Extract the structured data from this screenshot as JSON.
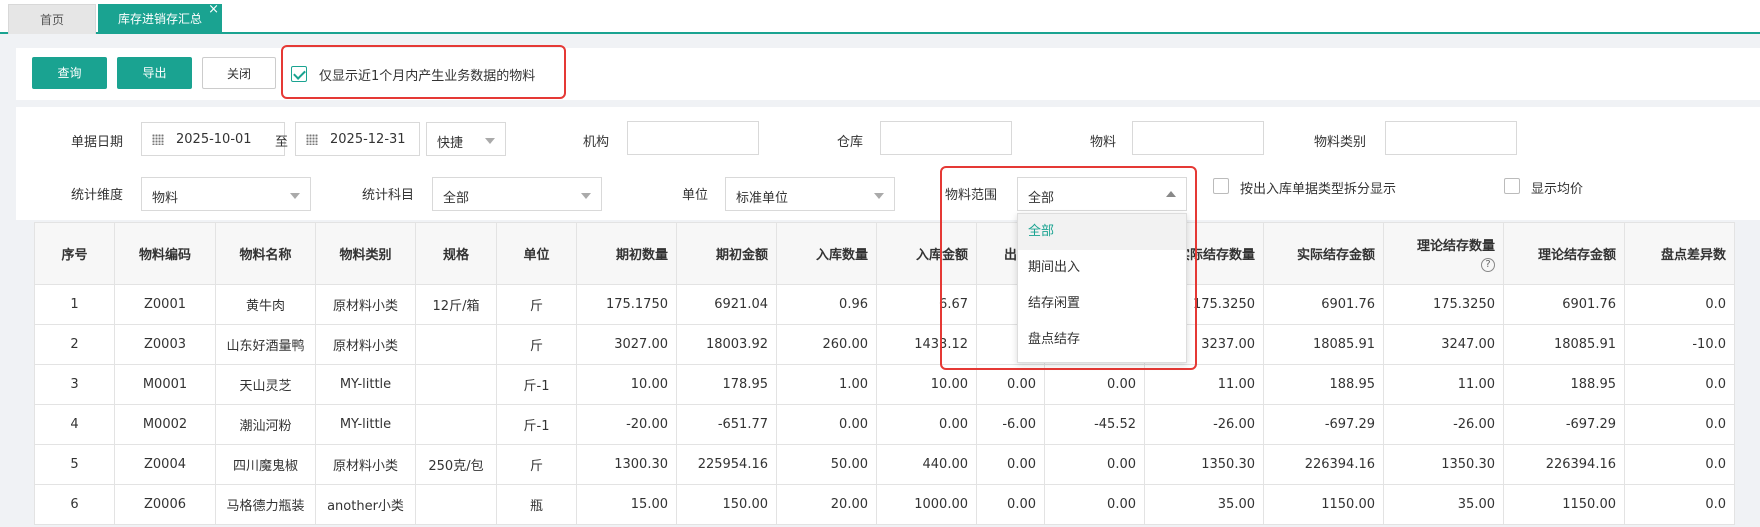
{
  "tabs": {
    "home": "首页",
    "active": "库存进销存汇总",
    "close": "×"
  },
  "toolbar": {
    "query": "查询",
    "export": "导出",
    "close": "关闭",
    "recent_only": "仅显示近1个月内产生业务数据的物料",
    "recent_checked": true
  },
  "filters": {
    "date_label": "单据日期",
    "date_from": "2025-10-01",
    "to_label": "至",
    "date_to": "2025-12-31",
    "quick": "快捷",
    "org_label": "机构",
    "warehouse_label": "仓库",
    "material_label": "物料",
    "category_label": "物料类别",
    "dimension_label": "统计维度",
    "dimension_value": "物料",
    "subject_label": "统计科目",
    "subject_value": "全部",
    "unit_label": "单位",
    "unit_value": "标准单位",
    "range_label": "物料范围",
    "range_value": "全部",
    "split_label": "按出入库单据类型拆分显示",
    "avg_label": "显示均价"
  },
  "dropdown": {
    "options": [
      "全部",
      "期间出入",
      "结存闲置",
      "盘点结存"
    ],
    "selected": "全部"
  },
  "table": {
    "headers": [
      "序号",
      "物料编码",
      "物料名称",
      "物料类别",
      "规格",
      "单位",
      "期初数量",
      "期初金额",
      "入库数量",
      "入库金额",
      "出",
      "",
      "实际结存数量",
      "实际结存金额",
      "理论结存数量",
      "理论结存金额",
      "盘点差异数"
    ],
    "rows": [
      [
        "1",
        "Z0001",
        "黄牛肉",
        "原材料小类",
        "12斤/箱",
        "斤",
        "175.1750",
        "6921.04",
        "0.96",
        "6.67",
        "",
        "",
        "175.3250",
        "6901.76",
        "175.3250",
        "6901.76",
        "0.0"
      ],
      [
        "2",
        "Z0003",
        "山东好酒量鸭",
        "原材料小类",
        "",
        "斤",
        "3027.00",
        "18003.92",
        "260.00",
        "1433.12",
        "",
        "",
        "3237.00",
        "18085.91",
        "3247.00",
        "18085.91",
        "-10.0"
      ],
      [
        "3",
        "M0001",
        "天山灵芝",
        "MY-little",
        "",
        "斤-1",
        "10.00",
        "178.95",
        "1.00",
        "10.00",
        "0.00",
        "0.00",
        "11.00",
        "188.95",
        "11.00",
        "188.95",
        "0.0"
      ],
      [
        "4",
        "M0002",
        "潮汕河粉",
        "MY-little",
        "",
        "斤-1",
        "-20.00",
        "-651.77",
        "0.00",
        "0.00",
        "-6.00",
        "-45.52",
        "-26.00",
        "-697.29",
        "-26.00",
        "-697.29",
        "0.0"
      ],
      [
        "5",
        "Z0004",
        "四川魔鬼椒",
        "原材料小类",
        "250克/包",
        "斤",
        "1300.30",
        "225954.16",
        "50.00",
        "440.00",
        "0.00",
        "0.00",
        "1350.30",
        "226394.16",
        "1350.30",
        "226394.16",
        "0.0"
      ],
      [
        "6",
        "Z0006",
        "马格德力瓶装",
        "another小类",
        "",
        "瓶",
        "15.00",
        "150.00",
        "20.00",
        "1000.00",
        "0.00",
        "0.00",
        "35.00",
        "1150.00",
        "35.00",
        "1150.00",
        "0.0"
      ]
    ]
  },
  "colors": {
    "accent": "#1aa391",
    "highlight": "#e53935"
  }
}
